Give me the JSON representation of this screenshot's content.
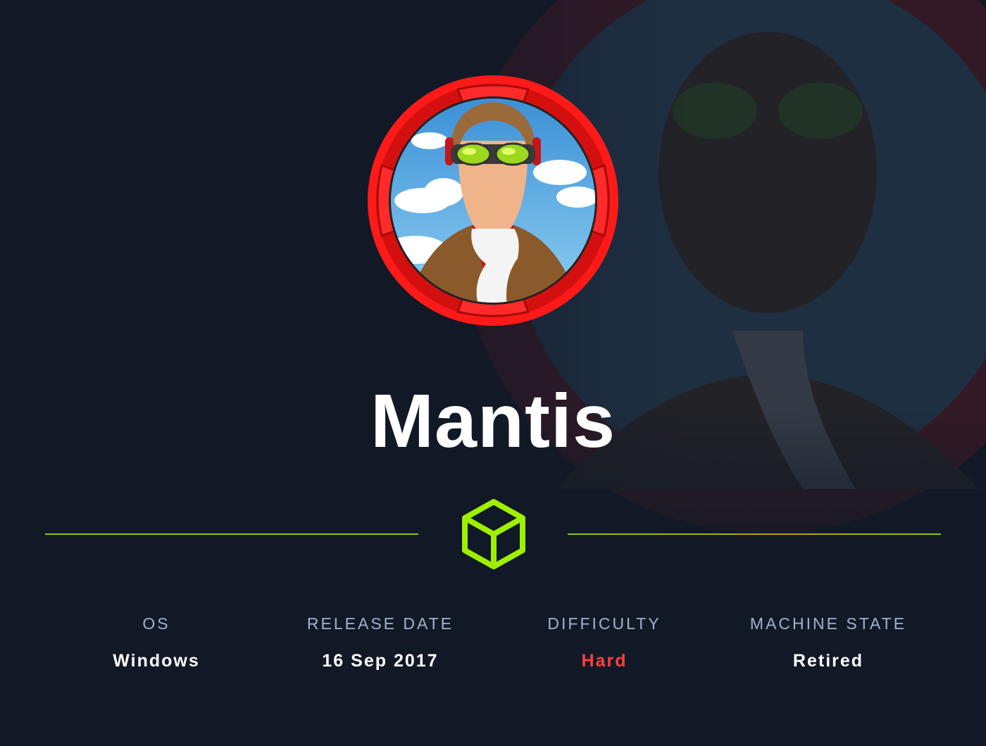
{
  "machine": {
    "name": "Mantis"
  },
  "stats": [
    {
      "label": "OS",
      "value": "Windows"
    },
    {
      "label": "RELEASE DATE",
      "value": "16 Sep 2017"
    },
    {
      "label": "DIFFICULTY",
      "value": "Hard"
    },
    {
      "label": "MACHINE STATE",
      "value": "Retired"
    }
  ],
  "colors": {
    "background": "#111927",
    "accent_green": "#9fef00",
    "divider": "#8fc31f",
    "difficulty_hard": "#ff3e3e",
    "label": "#a4b1cd",
    "avatar_ring": "#ff1a1a"
  },
  "icons": {
    "avatar": "pilot-avatar-icon",
    "logo": "hackthebox-cube-icon"
  }
}
